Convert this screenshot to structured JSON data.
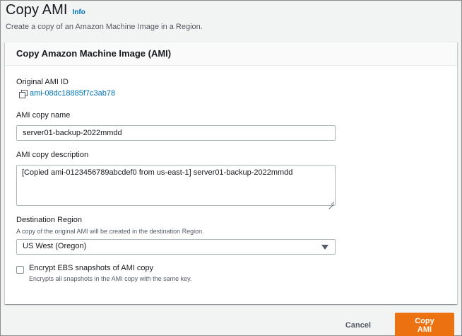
{
  "header": {
    "title": "Copy AMI",
    "info_label": "Info",
    "description": "Create a copy of an Amazon Machine Image in a Region."
  },
  "panel": {
    "title": "Copy Amazon Machine Image (AMI)",
    "original_ami": {
      "label": "Original AMI ID",
      "value": "ami-08dc18885f7c3ab78"
    },
    "copy_name": {
      "label": "AMI copy name",
      "value": "server01-backup-2022mmdd"
    },
    "copy_description": {
      "label": "AMI copy description",
      "value": "[Copied ami-0123456789abcdef0 from us-east-1] server01-backup-2022mmdd"
    },
    "destination_region": {
      "label": "Destination Region",
      "hint": "A copy of the original AMI will be created in the destination Region.",
      "selected": "US West (Oregon)"
    },
    "encrypt": {
      "label": "Encrypt EBS snapshots of AMI copy",
      "description": "Encrypts all snapshots in the AMI copy with the same key.",
      "checked": false
    }
  },
  "footer": {
    "cancel_label": "Cancel",
    "submit_label": "Copy AMI"
  },
  "colors": {
    "primary": "#ec7211",
    "link": "#0073bb",
    "background": "#f2f3f3"
  }
}
